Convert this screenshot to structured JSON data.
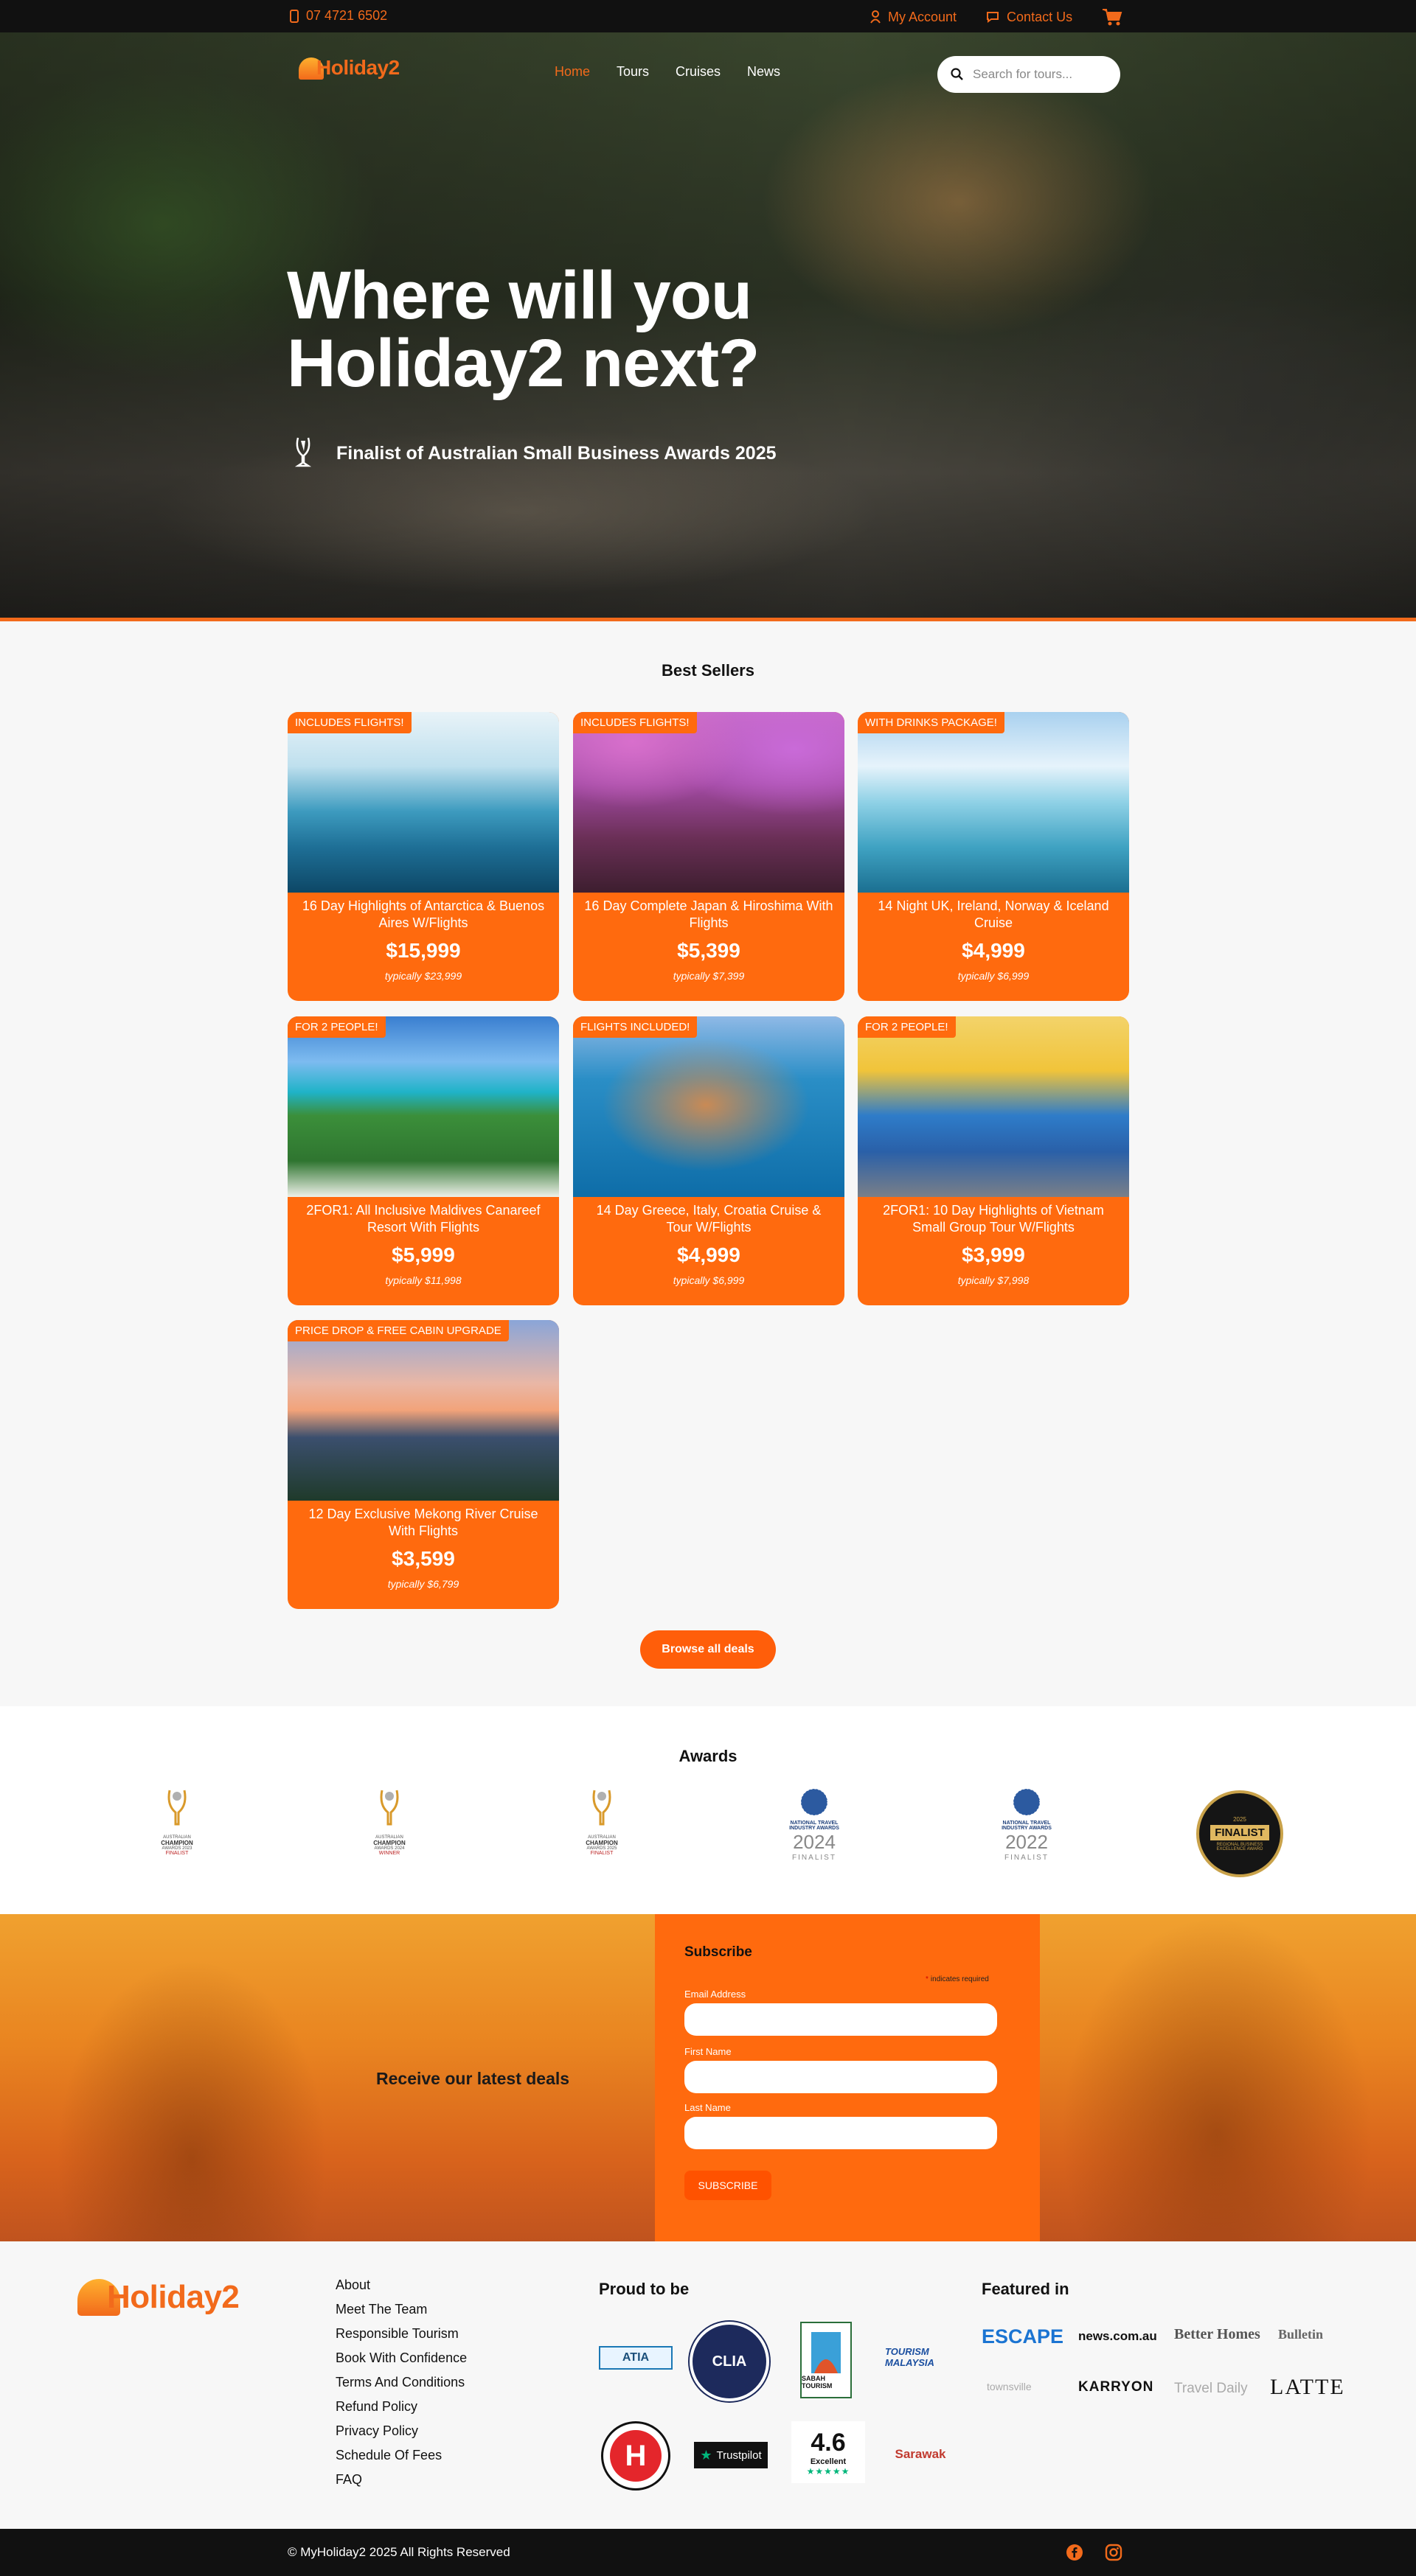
{
  "topbar": {
    "phone": "07 4721 6502",
    "account": "My Account",
    "contact": "Contact Us"
  },
  "brand": {
    "logo_text": "Holiday2",
    "logo_prefix": "My"
  },
  "nav": {
    "items": [
      "Home",
      "Tours",
      "Cruises",
      "News"
    ],
    "active": "Home"
  },
  "search": {
    "placeholder": "Search for tours..."
  },
  "hero": {
    "title_line1": "Where will you",
    "title_line2": "Holiday2 next?",
    "award_text": "Finalist of Australian Small Business Awards 2025"
  },
  "best_sellers": {
    "title": "Best Sellers",
    "cards": [
      {
        "badge": "INCLUDES FLIGHTS!",
        "title": "16 Day Highlights of Antarctica & Buenos Aires W/Flights",
        "price": "$15,999",
        "typical": "typically $23,999"
      },
      {
        "badge": "INCLUDES FLIGHTS!",
        "title": "16 Day Complete Japan & Hiroshima With Flights",
        "price": "$5,399",
        "typical": "typically $7,399"
      },
      {
        "badge": "WITH DRINKS PACKAGE!",
        "title": "14 Night UK, Ireland, Norway & Iceland Cruise",
        "price": "$4,999",
        "typical": "typically $6,999"
      },
      {
        "badge": "FOR 2 PEOPLE!",
        "title": "2FOR1: All Inclusive Maldives Canareef Resort With Flights",
        "price": "$5,999",
        "typical": "typically $11,998"
      },
      {
        "badge": "FLIGHTS INCLUDED!",
        "title": "14 Day Greece, Italy, Croatia Cruise & Tour W/Flights",
        "price": "$4,999",
        "typical": "typically $6,999"
      },
      {
        "badge": "FOR 2 PEOPLE!",
        "title": "2FOR1: 10 Day Highlights of Vietnam Small Group Tour W/Flights",
        "price": "$3,999",
        "typical": "typically $7,998"
      },
      {
        "badge": "PRICE DROP & FREE CABIN UPGRADE",
        "title": "12 Day Exclusive Mekong River Cruise With Flights",
        "price": "$3,599",
        "typical": "typically $6,799"
      }
    ],
    "browse_button": "Browse all deals"
  },
  "awards": {
    "title": "Awards",
    "items": [
      {
        "line1": "AUSTRALIAN",
        "line2": "CHAMPION",
        "line3": "AWARDS 2023",
        "line4": "FINALIST"
      },
      {
        "line1": "AUSTRALIAN",
        "line2": "CHAMPION",
        "line3": "AWARDS 2024",
        "line4": "WINNER"
      },
      {
        "line1": "AUSTRALIAN",
        "line2": "CHAMPION",
        "line3": "AWARDS 2025",
        "line4": "FINALIST"
      },
      {
        "line1": "NATIONAL TRAVEL",
        "line2": "INDUSTRY AWARDS",
        "line3": "2024",
        "line4": "FINALIST"
      },
      {
        "line1": "NATIONAL TRAVEL",
        "line2": "INDUSTRY AWARDS",
        "line3": "2022",
        "line4": "FINALIST"
      },
      {
        "line1": "2025",
        "line2": "FINALIST",
        "line3": "REGIONAL BUSINESS",
        "line4": "EXCELLENCE AWARD"
      }
    ]
  },
  "subscribe": {
    "tagline": "Receive our latest deals",
    "heading": "Subscribe",
    "required_note": "indicates required",
    "email_label": "Email Address",
    "first_label": "First Name",
    "last_label": "Last Name",
    "button": "SUBSCRIBE"
  },
  "footer": {
    "links": [
      "About",
      "Meet The Team",
      "Responsible Tourism",
      "Book With Confidence",
      "Terms And Conditions",
      "Refund Policy",
      "Privacy Policy",
      "Schedule Of Fees",
      "FAQ"
    ],
    "proud_heading": "Proud to be",
    "proud_logos": [
      "ATIA",
      "CLIA",
      "SABAH TOURISM",
      "TOURISM MALAYSIA",
      "H",
      "Trustpilot",
      "4.6",
      "Excellent",
      "Sarawak"
    ],
    "featured_heading": "Featured in",
    "featured": [
      "ESCAPE",
      "news.com.au",
      "Better Homes",
      "Bulletin",
      "townsville",
      "KARRYON",
      "Travel Daily",
      "LATTE"
    ],
    "copyright": "© MyHoliday2 2025 All Rights Reserved"
  },
  "colors": {
    "accent": "#ff6a0e",
    "topbar": "#111111"
  }
}
